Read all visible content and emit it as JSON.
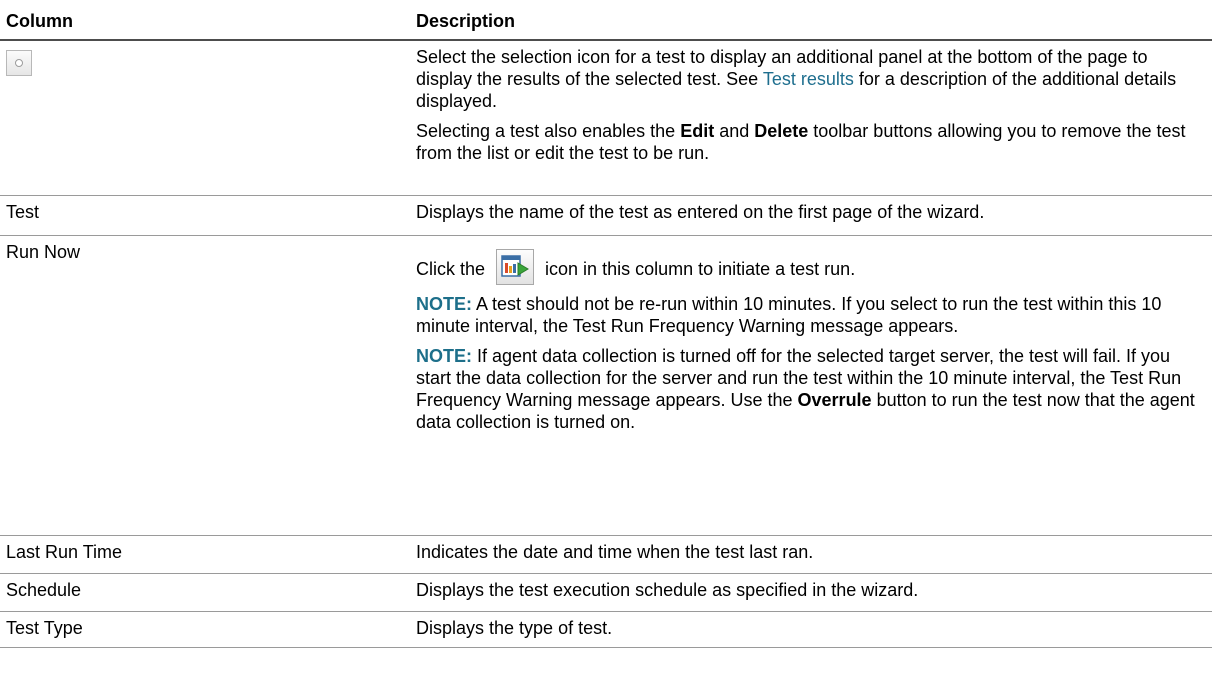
{
  "header": {
    "col1": "Column",
    "col2": "Description"
  },
  "rows": [
    {
      "name": "",
      "icon": "radio-selection-icon",
      "p1_a": "Select the selection icon for a test to display an additional panel at the bottom of the page to display the results of the selected test. See ",
      "p1_link": "Test results",
      "p1_b": " for a description of the additional details displayed.",
      "p2_a": "Selecting a test also enables the ",
      "p2_b1": "Edit",
      "p2_c": " and ",
      "p2_b2": "Delete",
      "p2_d": " toolbar buttons allowing you to remove the test from the list or edit the test to be run."
    },
    {
      "name": "Test",
      "desc": "Displays the name of the test as entered on the first page of the wizard."
    },
    {
      "name": "Run Now",
      "icon": "run-now-icon",
      "run_a": "Click the ",
      "run_b": " icon in this column to initiate a test run.",
      "note1_label": "NOTE:",
      "note1_text": " A test should not be re-run within 10 minutes. If you select to run the test within this 10 minute interval, the Test Run Frequency Warning message appears.",
      "note2_label": "NOTE:",
      "note2_text": " If agent data collection is turned off for the selected target server, the test will fail. If you start the data collection for the server and run the test within the 10 minute interval, the Test Run Frequency Warning message appears. Use the ",
      "note2_bold": "Overrule",
      "note2_end": " button to run the test now that the agent data collection is turned on."
    },
    {
      "name": "Last Run Time",
      "desc": "Indicates the date and time when the test last ran."
    },
    {
      "name": "Schedule",
      "desc": "Displays the test execution schedule as specified in the wizard."
    },
    {
      "name": "Test Type",
      "desc": "Displays the type of test."
    }
  ],
  "colors": {
    "link": "#1e6e8e",
    "note": "#1d6f8a",
    "header_rule": "#4d4d4d",
    "row_rule": "#9a9a9a"
  }
}
